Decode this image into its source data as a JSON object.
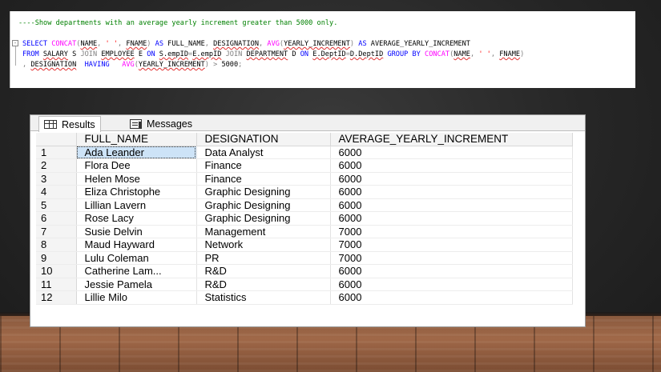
{
  "editor": {
    "comment": "----Show departments with an average yearly increment greater than 5000 only.",
    "collapse_glyph": "-",
    "line1": [
      {
        "t": "SELECT ",
        "c": "kw"
      },
      {
        "t": "CONCAT",
        "c": "fn"
      },
      {
        "t": "(",
        "c": "gr"
      },
      {
        "t": "NAME",
        "c": "sq"
      },
      {
        "t": ", ",
        "c": "gr"
      },
      {
        "t": "' '",
        "c": "str"
      },
      {
        "t": ", ",
        "c": "gr"
      },
      {
        "t": "FNAME",
        "c": "sq"
      },
      {
        "t": ") ",
        "c": "gr"
      },
      {
        "t": "AS ",
        "c": "kw"
      },
      {
        "t": "FULL_NAME",
        "c": ""
      },
      {
        "t": ", ",
        "c": "gr"
      },
      {
        "t": "DESIGNATION",
        "c": "sq"
      },
      {
        "t": ", ",
        "c": "gr"
      },
      {
        "t": "AVG",
        "c": "fn"
      },
      {
        "t": "(",
        "c": "gr"
      },
      {
        "t": "YEARLY_INCREMENT",
        "c": "sq"
      },
      {
        "t": ") ",
        "c": "gr"
      },
      {
        "t": "AS ",
        "c": "kw"
      },
      {
        "t": "AVERAGE_YEARLY_INCREMENT",
        "c": ""
      }
    ],
    "line2": [
      {
        "t": "FROM ",
        "c": "kw"
      },
      {
        "t": "SALARY",
        "c": "sq"
      },
      {
        "t": " S ",
        "c": ""
      },
      {
        "t": "JOIN ",
        "c": "gr"
      },
      {
        "t": "EMPLOYEE",
        "c": "sq"
      },
      {
        "t": " E ",
        "c": ""
      },
      {
        "t": "ON ",
        "c": "kw"
      },
      {
        "t": "S.empID",
        "c": "sq"
      },
      {
        "t": "=",
        "c": "gr"
      },
      {
        "t": "E.empID",
        "c": "sq"
      },
      {
        "t": " JOIN ",
        "c": "gr"
      },
      {
        "t": "DEPARTMENT",
        "c": "sq"
      },
      {
        "t": " D ",
        "c": ""
      },
      {
        "t": "ON ",
        "c": "kw"
      },
      {
        "t": "E.DeptID",
        "c": "sq"
      },
      {
        "t": "=",
        "c": "gr"
      },
      {
        "t": "D.DeptID",
        "c": "sq"
      },
      {
        "t": " GROUP BY ",
        "c": "kw"
      },
      {
        "t": "CONCAT",
        "c": "fn"
      },
      {
        "t": "(",
        "c": "gr"
      },
      {
        "t": "NAME",
        "c": "sq"
      },
      {
        "t": ", ",
        "c": "gr"
      },
      {
        "t": "' '",
        "c": "str"
      },
      {
        "t": ", ",
        "c": "gr"
      },
      {
        "t": "FNAME",
        "c": "sq"
      },
      {
        "t": ")",
        "c": "gr"
      }
    ],
    "line3": [
      {
        "t": ", ",
        "c": "gr"
      },
      {
        "t": "DESIGNATION",
        "c": "sq"
      },
      {
        "t": "  HAVING   ",
        "c": "kw"
      },
      {
        "t": "AVG",
        "c": "fn"
      },
      {
        "t": "(",
        "c": "gr"
      },
      {
        "t": "YEARLY_INCREMENT",
        "c": "sq"
      },
      {
        "t": ") ",
        "c": "gr"
      },
      {
        "t": "> ",
        "c": "gr"
      },
      {
        "t": "5000",
        "c": ""
      },
      {
        "t": ";",
        "c": "gr"
      }
    ]
  },
  "tabs": {
    "results_label": "Results",
    "messages_label": "Messages"
  },
  "grid": {
    "columns": [
      "FULL_NAME",
      "DESIGNATION",
      "AVERAGE_YEARLY_INCREMENT"
    ],
    "selected_row": 1,
    "rows": [
      [
        "1",
        "Ada Leander",
        "Data Analyst",
        "6000"
      ],
      [
        "2",
        "Flora Dee",
        "Finance",
        "6000"
      ],
      [
        "3",
        "Helen Mose",
        "Finance",
        "6000"
      ],
      [
        "4",
        "Eliza Christophe",
        "Graphic Designing",
        "6000"
      ],
      [
        "5",
        "Lillian Lavern",
        "Graphic Designing",
        "6000"
      ],
      [
        "6",
        "Rose Lacy",
        "Graphic Designing",
        "6000"
      ],
      [
        "7",
        "Susie Delvin",
        "Management",
        "7000"
      ],
      [
        "8",
        "Maud Hayward",
        "Network",
        "7000"
      ],
      [
        "9",
        "Lulu Coleman",
        "PR",
        "7000"
      ],
      [
        "10",
        "Catherine Lam...",
        "R&D",
        "6000"
      ],
      [
        "11",
        "Jessie Pamela",
        "R&D",
        "6000"
      ],
      [
        "12",
        "Lillie Milo",
        "Statistics",
        "6000"
      ]
    ]
  }
}
